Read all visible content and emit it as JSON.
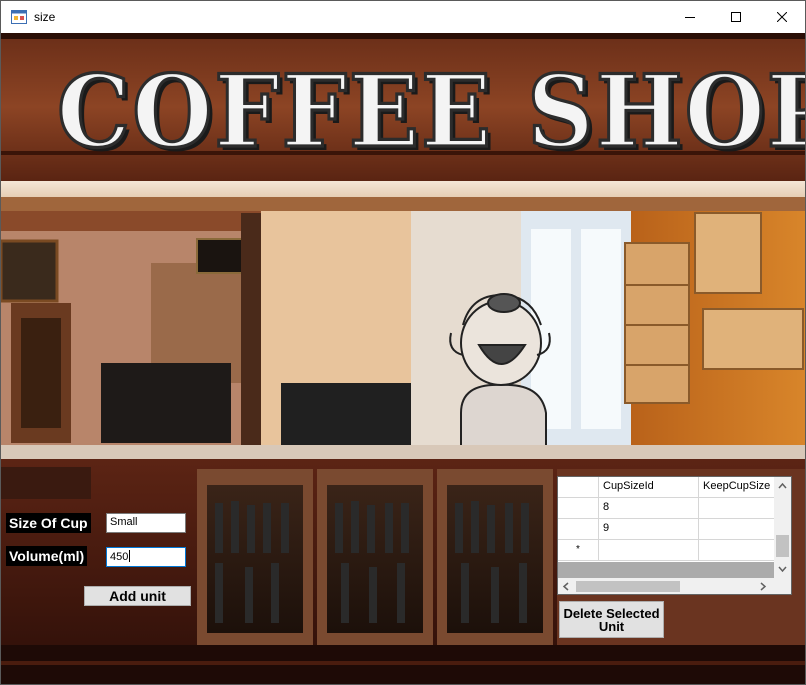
{
  "window": {
    "title": "size",
    "min_icon": "minimize-icon",
    "max_icon": "maximize-icon",
    "close_icon": "close-icon"
  },
  "banner": {
    "text": "COFFEE SHOP"
  },
  "form": {
    "size_label": "Size Of Cup",
    "size_value": "Small",
    "volume_label": "Volume(ml)",
    "volume_value": "450",
    "add_button": "Add unit",
    "delete_button_line1": "Delete Selected",
    "delete_button_line2": "Unit"
  },
  "grid": {
    "columns": [
      "CupSizeId",
      "KeepCupSize"
    ],
    "rows": [
      [
        "8",
        ""
      ],
      [
        "9",
        ""
      ]
    ],
    "new_row_marker": "*"
  },
  "colors": {
    "accent": "#0078d7",
    "wood": "#4a1c0e",
    "wall_orange": "#c8751e"
  }
}
